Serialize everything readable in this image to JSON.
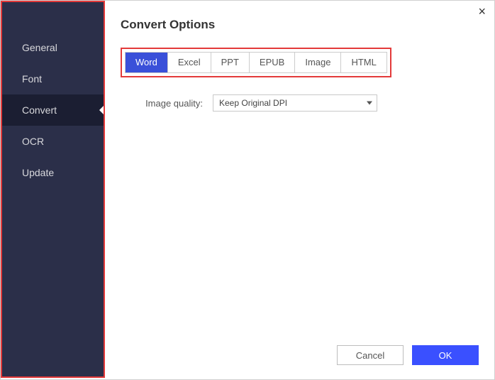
{
  "sidebar": {
    "items": [
      {
        "label": "General",
        "active": false
      },
      {
        "label": "Font",
        "active": false
      },
      {
        "label": "Convert",
        "active": true
      },
      {
        "label": "OCR",
        "active": false
      },
      {
        "label": "Update",
        "active": false
      }
    ]
  },
  "header": {
    "title": "Convert Options"
  },
  "format_tabs": {
    "items": [
      {
        "label": "Word",
        "active": true
      },
      {
        "label": "Excel",
        "active": false
      },
      {
        "label": "PPT",
        "active": false
      },
      {
        "label": "EPUB",
        "active": false
      },
      {
        "label": "Image",
        "active": false
      },
      {
        "label": "HTML",
        "active": false
      }
    ]
  },
  "image_quality": {
    "label": "Image quality:",
    "value": "Keep Original DPI"
  },
  "footer": {
    "cancel": "Cancel",
    "ok": "OK"
  }
}
